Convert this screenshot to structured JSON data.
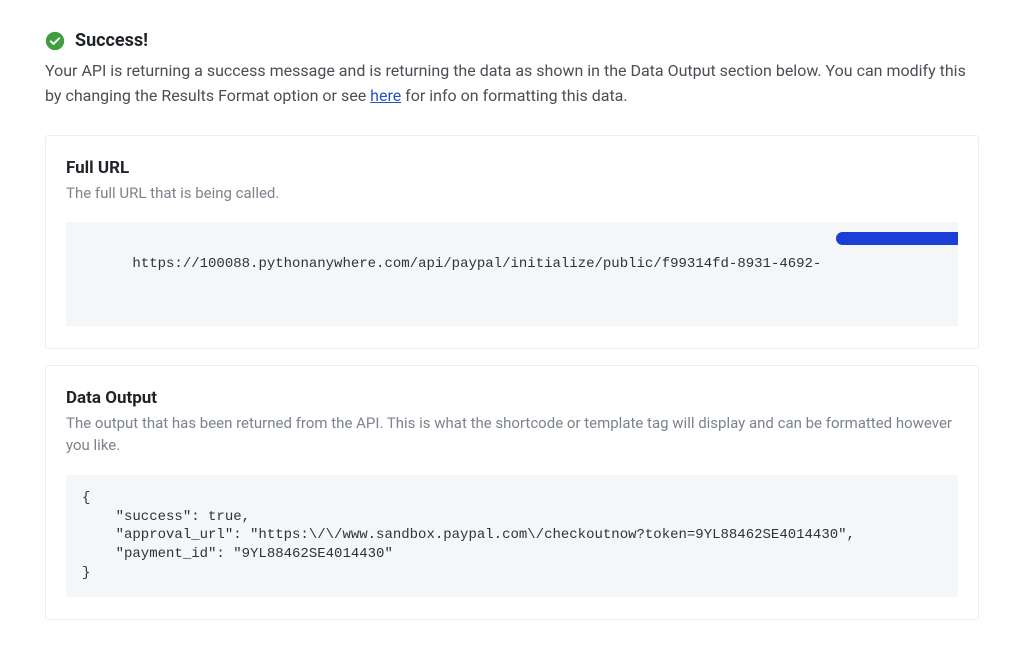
{
  "success": {
    "title": "Success!",
    "description_before": "Your API is returning a success message and is returning the data as shown in the Data Output section below. You can modify this by changing the Results Format option or see ",
    "link_text": "here",
    "description_after": " for info on formatting this data."
  },
  "full_url_panel": {
    "title": "Full URL",
    "subtitle": "The full URL that is being called.",
    "value": "https://100088.pythonanywhere.com/api/paypal/initialize/public/f99314fd-8931-4692-"
  },
  "data_output_panel": {
    "title": "Data Output",
    "subtitle": "The output that has been returned from the API. This is what the shortcode or template tag will display and can be formatted however you like.",
    "code": "{\n    \"success\": true,\n    \"approval_url\": \"https:\\/\\/www.sandbox.paypal.com\\/checkoutnow?token=9YL88462SE4014430\",\n    \"payment_id\": \"9YL88462SE4014430\"\n}"
  }
}
